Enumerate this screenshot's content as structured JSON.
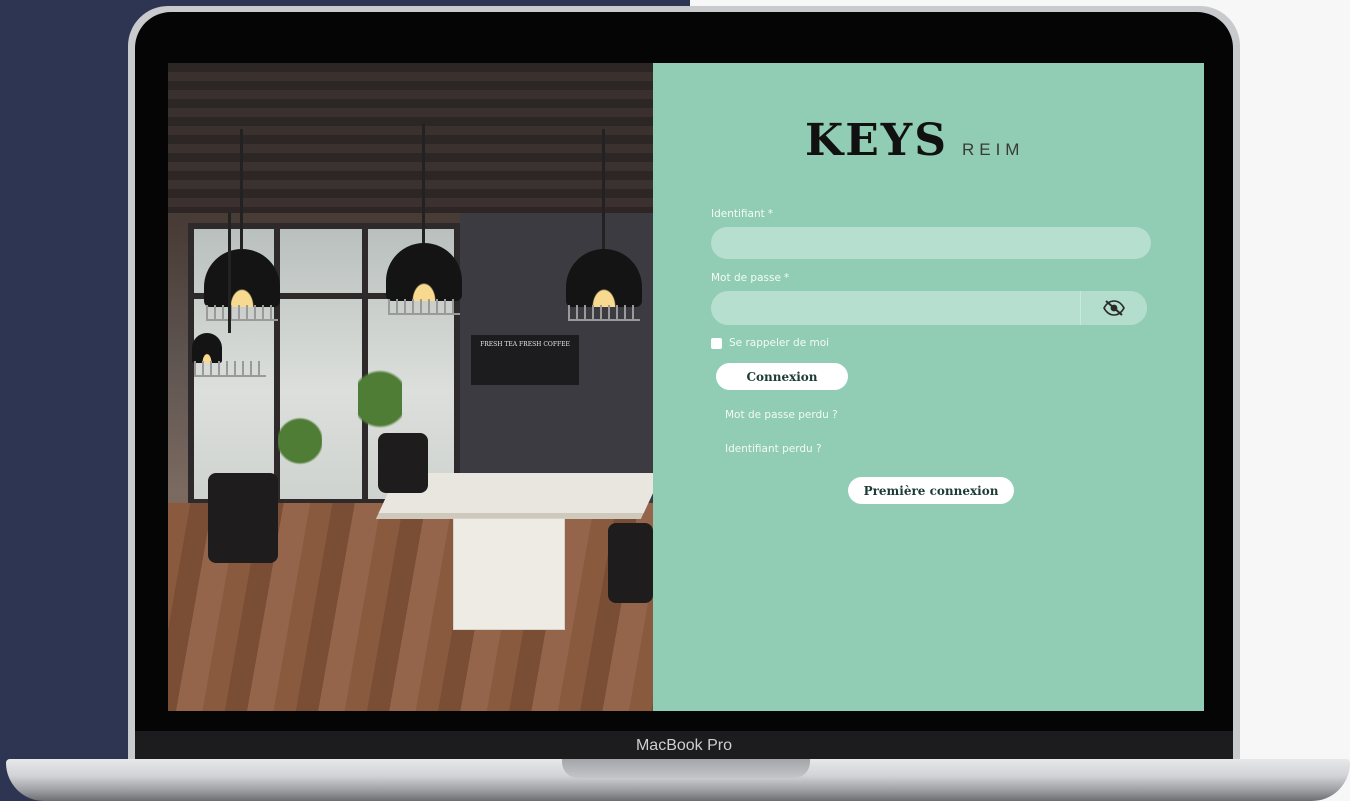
{
  "device": {
    "model_label": "MacBook Pro"
  },
  "photo": {
    "chalkboard_text": "FRESH TEA FRESH COFFEE"
  },
  "brand": {
    "logo_main": "KEYS",
    "logo_sub": "REIM"
  },
  "form": {
    "username": {
      "label": "Identifiant",
      "required_mark": "*",
      "value": "",
      "placeholder": ""
    },
    "password": {
      "label": "Mot de passe",
      "required_mark": "*",
      "value": "",
      "placeholder": ""
    },
    "remember_label": "Se rappeler de moi",
    "remember_checked": false,
    "submit_label": "Connexion",
    "lost_password_link": "Mot de passe perdu ?",
    "lost_username_link": "Identifiant perdu ?",
    "first_login_label": "Première connexion"
  },
  "icons": {
    "toggle_password": "eye-slash-icon"
  },
  "colors": {
    "panel_bg": "#91ccb4",
    "input_bg": "#b6dfcf",
    "page_left_bg": "#2d3552"
  }
}
